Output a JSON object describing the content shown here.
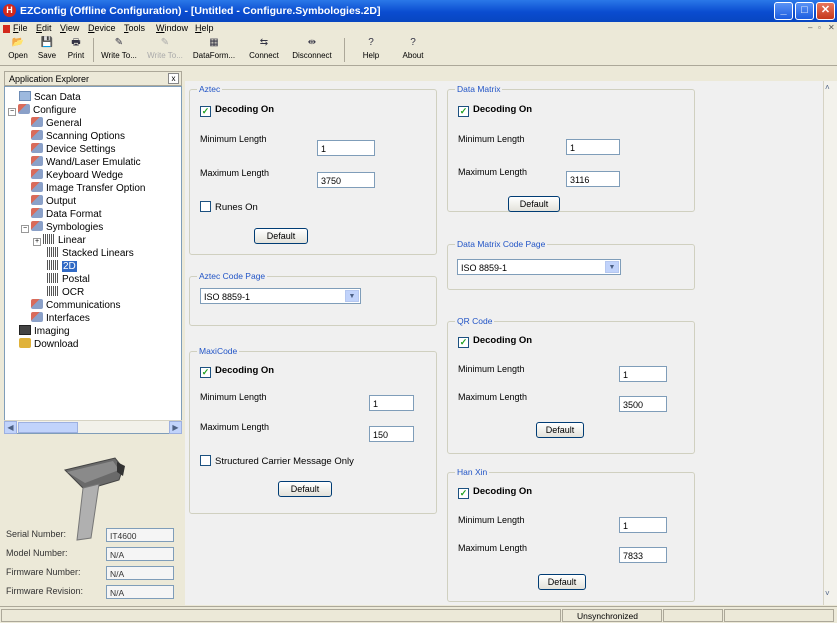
{
  "window": {
    "title": "EZConfig  (Offline Configuration) - [Untitled - Configure.Symbologies.2D]",
    "app_icon_letter": "H"
  },
  "menu": [
    "File",
    "Edit",
    "View",
    "Device",
    "Tools",
    "Window",
    "Help"
  ],
  "toolbar": [
    {
      "label": "Open",
      "icon": "folder-open-icon",
      "glyph": "📂",
      "enabled": true
    },
    {
      "label": "Save",
      "icon": "floppy-icon",
      "glyph": "💾",
      "enabled": true
    },
    {
      "label": "Print",
      "icon": "printer-icon",
      "glyph": "🖶",
      "enabled": true
    },
    {
      "label": "Write To...",
      "icon": "write-to-icon",
      "glyph": "✎",
      "enabled": true
    },
    {
      "label": "Write To...",
      "icon": "write-to-disabled-icon",
      "glyph": "✎",
      "enabled": false
    },
    {
      "label": "DataForm...",
      "icon": "data-format-icon",
      "glyph": "▦",
      "enabled": true
    },
    {
      "label": "Connect",
      "icon": "connect-icon",
      "glyph": "⇆",
      "enabled": true
    },
    {
      "label": "Disconnect",
      "icon": "disconnect-icon",
      "glyph": "⇹",
      "enabled": true
    },
    {
      "label": "Help",
      "icon": "help-icon",
      "glyph": "?",
      "enabled": true
    },
    {
      "label": "About",
      "icon": "about-icon",
      "glyph": "?",
      "enabled": true
    }
  ],
  "explorer": {
    "title": "Application Explorer",
    "tree": [
      {
        "label": "Scan Data",
        "icon": "scan-data-icon"
      },
      {
        "label": "Configure",
        "icon": "configure-icon"
      },
      {
        "label": "General",
        "icon": "configure-icon"
      },
      {
        "label": "Scanning Options",
        "icon": "configure-icon"
      },
      {
        "label": "Device Settings",
        "icon": "configure-icon"
      },
      {
        "label": "Wand/Laser Emulatic",
        "icon": "configure-icon"
      },
      {
        "label": "Keyboard Wedge",
        "icon": "configure-icon"
      },
      {
        "label": "Image Transfer Option",
        "icon": "configure-icon"
      },
      {
        "label": "Output",
        "icon": "configure-icon"
      },
      {
        "label": "Data Format",
        "icon": "configure-icon"
      },
      {
        "label": "Symbologies",
        "icon": "configure-icon"
      },
      {
        "label": "Linear",
        "icon": "barcode-icon"
      },
      {
        "label": "Stacked Linears",
        "icon": "barcode-icon"
      },
      {
        "label": "2D",
        "icon": "2d-code-icon",
        "selected": true
      },
      {
        "label": "Postal",
        "icon": "postal-icon"
      },
      {
        "label": "OCR",
        "icon": "ocr-icon"
      },
      {
        "label": "Communications",
        "icon": "configure-icon"
      },
      {
        "label": "Interfaces",
        "icon": "configure-icon"
      },
      {
        "label": "Imaging",
        "icon": "imaging-icon"
      },
      {
        "label": "Download",
        "icon": "download-icon"
      }
    ]
  },
  "device": {
    "serial_label": "Serial Number:",
    "serial_value": "IT4600",
    "model_label": "Model Number:",
    "model_value": "N/A",
    "firmware_label": "Firmware Number:",
    "firmware_value": "N/A",
    "revision_label": "Firmware Revision:",
    "revision_value": "N/A"
  },
  "aztec": {
    "title": "Aztec",
    "decoding": "Decoding On",
    "min_label": "Minimum Length",
    "min_value": "1",
    "max_label": "Maximum Length",
    "max_value": "3750",
    "runes": "Runes On",
    "default": "Default",
    "codepage_title": "Aztec Code Page",
    "codepage_value": "ISO 8859-1"
  },
  "maxicode": {
    "title": "MaxiCode",
    "decoding": "Decoding On",
    "min_label": "Minimum Length",
    "min_value": "1",
    "max_label": "Maximum Length",
    "max_value": "150",
    "structured": "Structured Carrier Message Only",
    "default": "Default"
  },
  "datamatrix": {
    "title": "Data Matrix",
    "decoding": "Decoding On",
    "min_label": "Minimum Length",
    "min_value": "1",
    "max_label": "Maximum Length",
    "max_value": "3116",
    "default": "Default",
    "codepage_title": "Data Matrix Code Page",
    "codepage_value": "ISO 8859-1"
  },
  "qrcode": {
    "title": "QR Code",
    "decoding": "Decoding On",
    "min_label": "Minimum Length",
    "min_value": "1",
    "max_label": "Maximum Length",
    "max_value": "3500",
    "default": "Default"
  },
  "hanxin": {
    "title": "Han Xin",
    "decoding": "Decoding On",
    "min_label": "Minimum Length",
    "min_value": "1",
    "max_label": "Maximum Length",
    "max_value": "7833",
    "default": "Default"
  },
  "status": {
    "sync": "Unsynchronized"
  },
  "colors": {
    "title_bar": "#0a4cd0",
    "group_title": "#2154c6",
    "selection": "#316ac5"
  }
}
